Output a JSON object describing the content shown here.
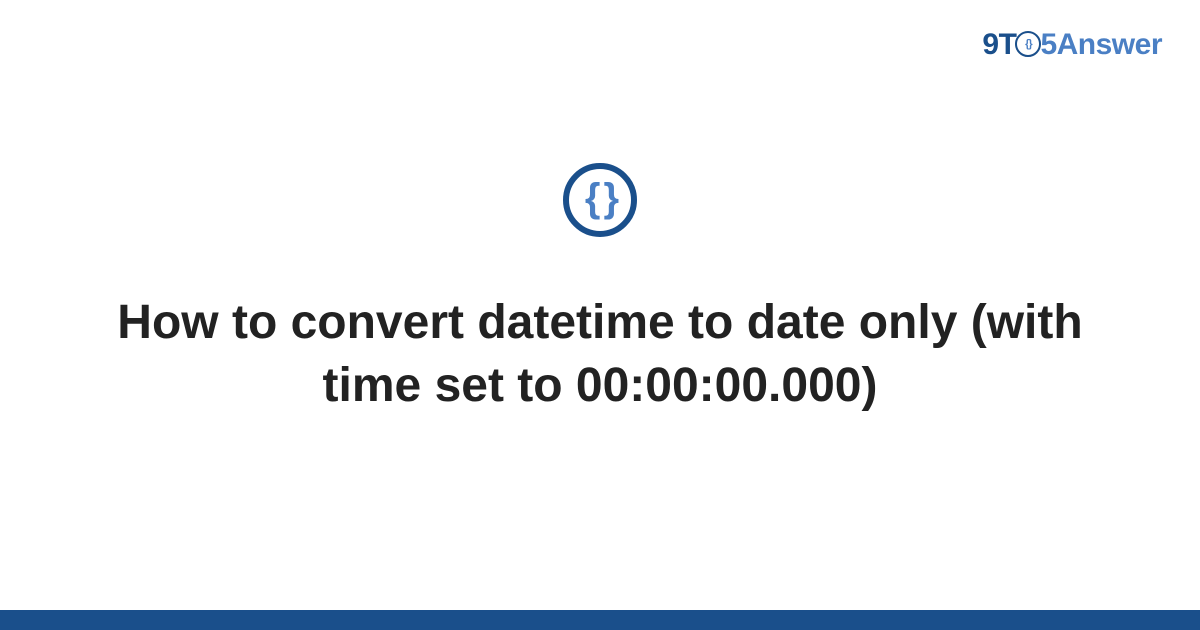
{
  "logo": {
    "part1": "9T",
    "circle_inner": "{}",
    "part2": "5Answer"
  },
  "icon": {
    "braces": "{ }"
  },
  "title": "How to convert datetime to date only (with time set to 00:00:00.000)"
}
